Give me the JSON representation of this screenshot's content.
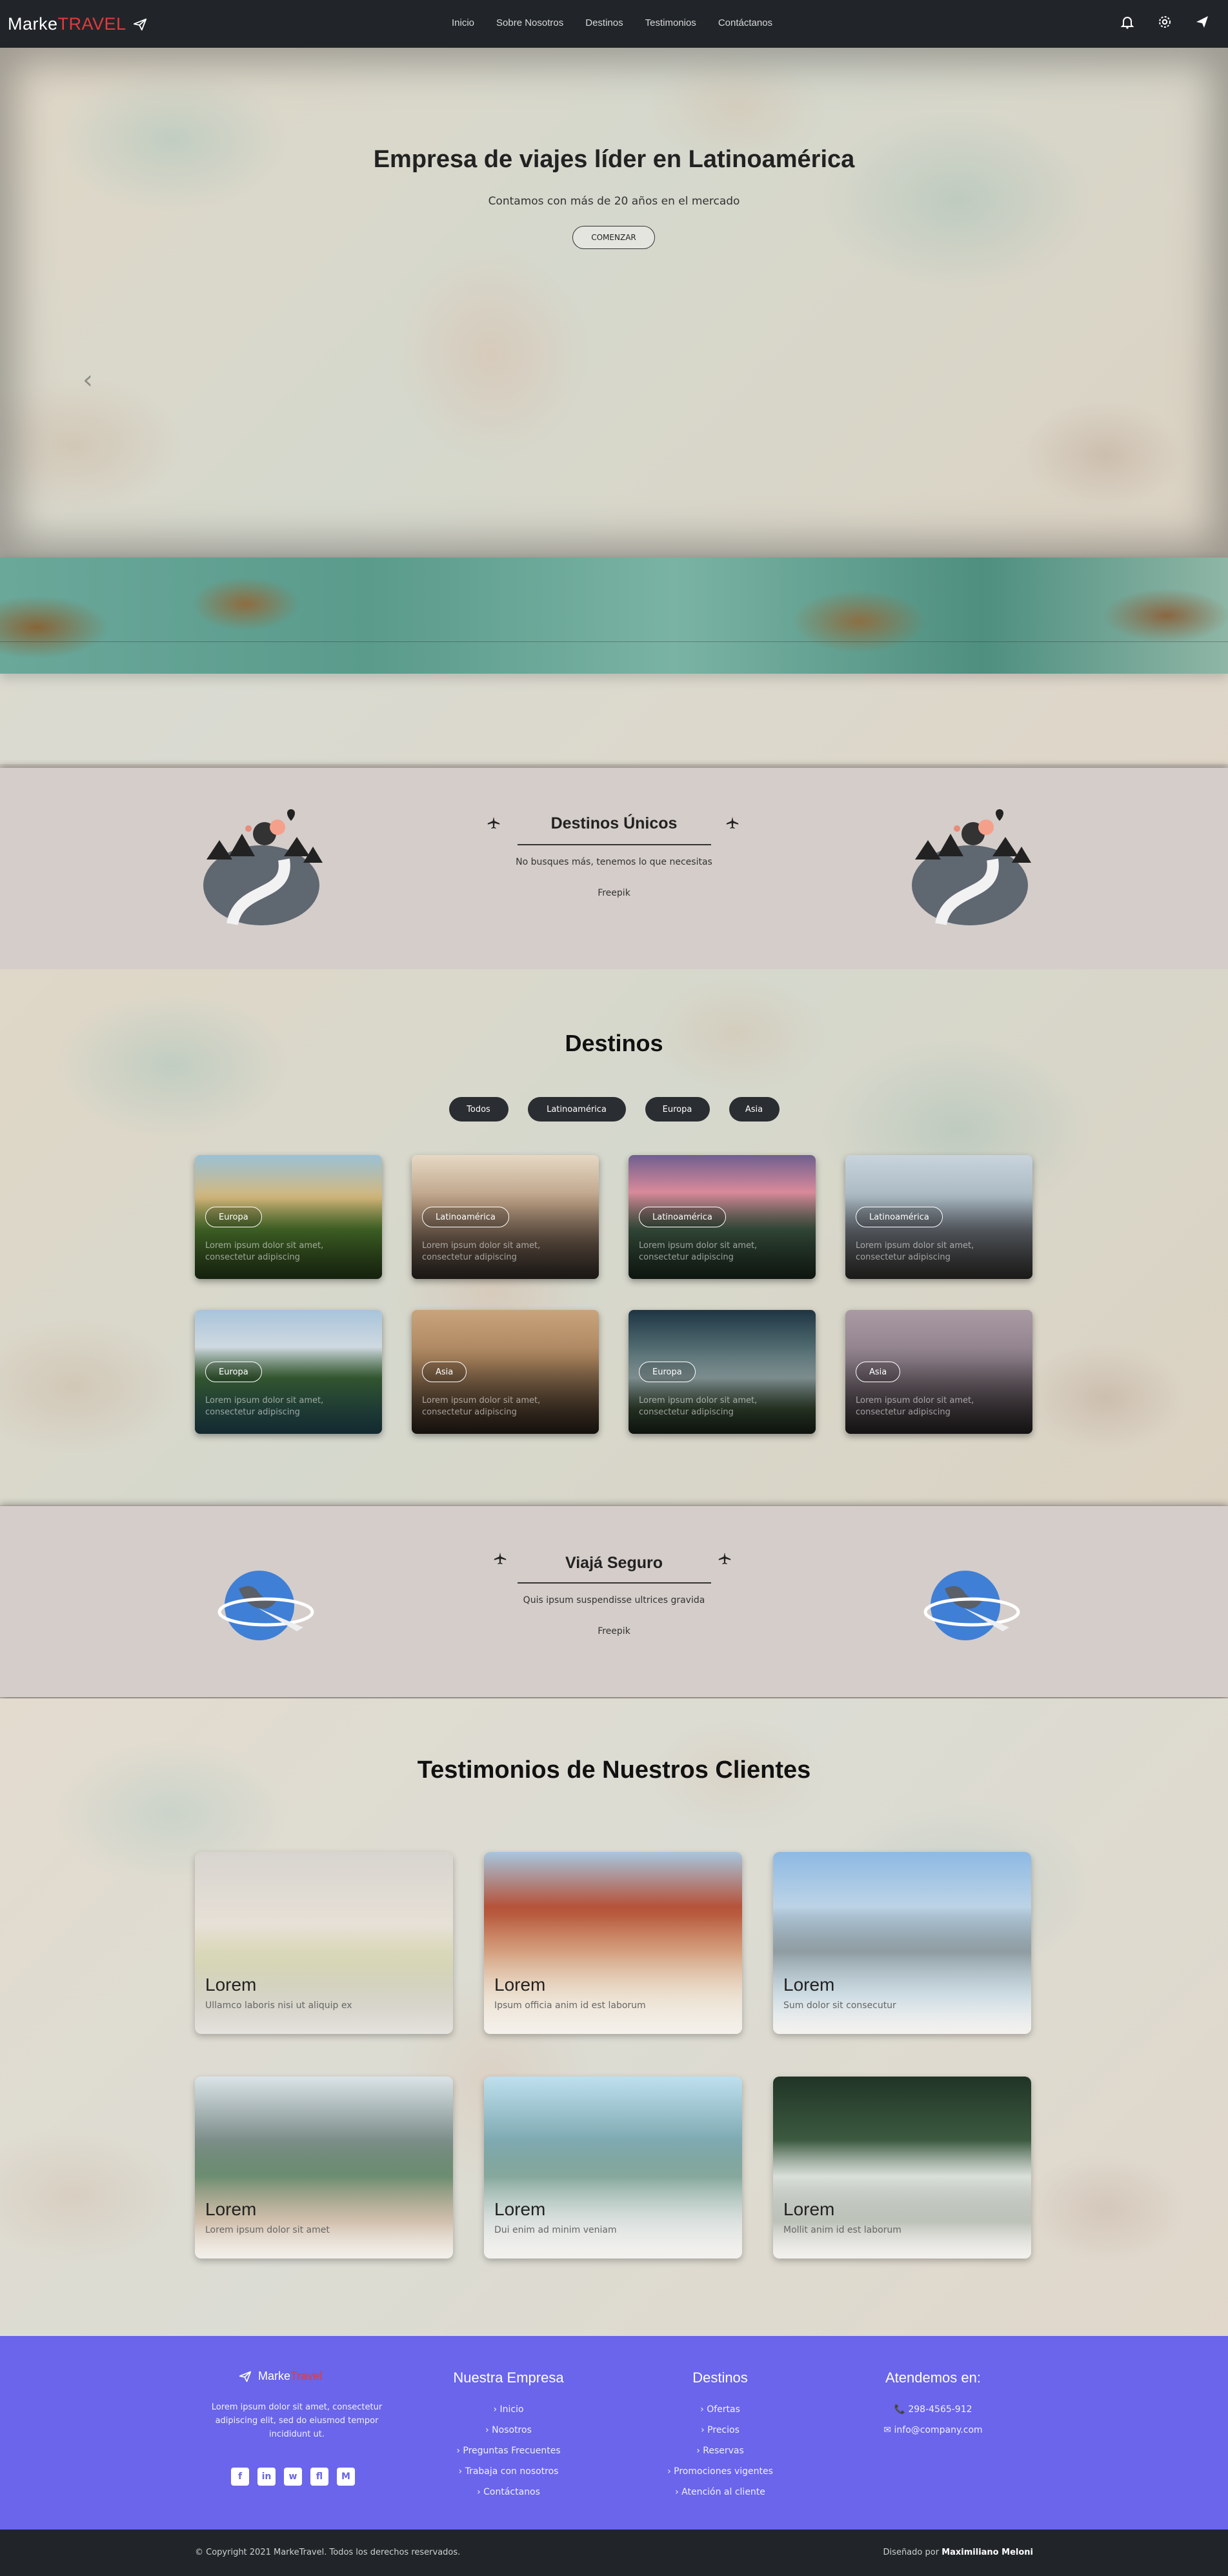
{
  "navbar": {
    "brand_main": "Marke",
    "brand_accent": "TRAVEL",
    "links": [
      "Inicio",
      "Sobre Nosotros",
      "Destinos",
      "Testimonios",
      "Contáctanos"
    ],
    "icons": [
      "bell-icon",
      "gear-icon",
      "send-plane-icon"
    ]
  },
  "hero": {
    "title": "Empresa de viajes líder en Latinoamérica",
    "subtitle": "Contamos con más de 20 años en el mercado",
    "button": "COMENZAR",
    "prev_arrow": "‹"
  },
  "band1": {
    "title": "Destinos Únicos",
    "subtitle": "No busques más, tenemos lo que necesitas",
    "credit": "Freepik"
  },
  "destinos": {
    "title": "Destinos",
    "filters": [
      "Todos",
      "Latinoamérica",
      "Europa",
      "Asia"
    ],
    "cards": [
      {
        "tag": "Europa",
        "desc": "Lorem ipsum dolor sit amet, consectetur adipiscing"
      },
      {
        "tag": "Latinoamérica",
        "desc": "Lorem ipsum dolor sit amet, consectetur adipiscing"
      },
      {
        "tag": "Latinoamérica",
        "desc": "Lorem ipsum dolor sit amet, consectetur adipiscing"
      },
      {
        "tag": "Latinoamérica",
        "desc": "Lorem ipsum dolor sit amet, consectetur adipiscing"
      },
      {
        "tag": "Europa",
        "desc": "Lorem ipsum dolor sit amet, consectetur adipiscing"
      },
      {
        "tag": "Asia",
        "desc": "Lorem ipsum dolor sit amet, consectetur adipiscing"
      },
      {
        "tag": "Europa",
        "desc": "Lorem ipsum dolor sit amet, consectetur adipiscing"
      },
      {
        "tag": "Asia",
        "desc": "Lorem ipsum dolor sit amet, consectetur adipiscing"
      }
    ]
  },
  "band2": {
    "title": "Viajá Seguro",
    "subtitle": "Quis ipsum suspendisse ultrices gravida",
    "credit": "Freepik"
  },
  "testimonios": {
    "title": "Testimonios de Nuestros Clientes",
    "cards": [
      {
        "name": "Lorem",
        "text": "Ullamco laboris nisi ut aliquip ex"
      },
      {
        "name": "Lorem",
        "text": "Ipsum officia anim id est laborum"
      },
      {
        "name": "Lorem",
        "text": "Sum dolor sit consecutur"
      },
      {
        "name": "Lorem",
        "text": "Lorem ipsum dolor sit amet"
      },
      {
        "name": "Lorem",
        "text": "Dui enim ad minim veniam"
      },
      {
        "name": "Lorem",
        "text": "Mollit anim id est laborum"
      }
    ]
  },
  "footer": {
    "brand_main": "Marke",
    "brand_accent": "Travel",
    "about": "Lorem ipsum dolor sit amet, consectetur adipiscing elit, sed do eiusmod tempor incididunt ut.",
    "social": [
      "f",
      "in",
      "w",
      "fl",
      "M"
    ],
    "col1": {
      "title": "Nuestra Empresa",
      "items": [
        "Inicio",
        "Nosotros",
        "Preguntas Frecuentes",
        "Trabaja con nosotros",
        "Contáctanos"
      ]
    },
    "col2": {
      "title": "Destinos",
      "items": [
        "Ofertas",
        "Precios",
        "Reservas",
        "Promociones vigentes",
        "Atención al cliente"
      ]
    },
    "col3": {
      "title": "Atendemos en:",
      "phone": "📞 298-4565-912",
      "email": "✉ info@company.com"
    },
    "copyright": "© Copyright 2021 MarkeTravel. Todos los derechos reservados.",
    "designed_label": "Diseñado por",
    "designer": "Maximiliano Meloni"
  },
  "colors": {
    "navbar": "#212529",
    "accent": "#e23b3b",
    "footer": "#6a65ea",
    "band": "#d4cdc9",
    "filter": "#2a2d31"
  }
}
